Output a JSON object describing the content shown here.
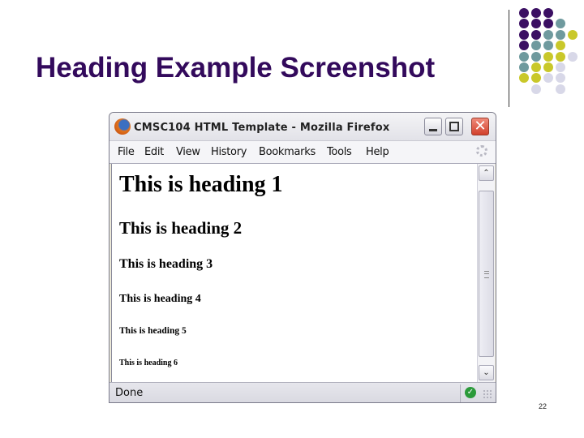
{
  "slide": {
    "title": "Heading Example Screenshot",
    "page_number": "22",
    "colors": {
      "title": "#330a5c",
      "dot_purple": "#3b0f63",
      "dot_teal": "#6f9a9e",
      "dot_yellow": "#c9c82a",
      "dot_lavender": "#d8d8e8"
    }
  },
  "browser": {
    "window_title": "CMSC104 HTML Template - Mozilla Firefox",
    "menu": [
      "File",
      "Edit",
      "View",
      "History",
      "Bookmarks",
      "Tools",
      "Help"
    ],
    "content": {
      "h1": "This is heading 1",
      "h2": "This is heading 2",
      "h3": "This is heading 3",
      "h4": "This is heading 4",
      "h5": "This is heading 5",
      "h6": "This is heading 6"
    },
    "status": "Done",
    "icons": {
      "app": "firefox-icon",
      "minimize": "minimize-icon",
      "maximize": "maximize-icon",
      "close": "close-icon",
      "throbber": "throbber-icon",
      "scroll_up": "chevron-up-icon",
      "scroll_down": "chevron-down-icon",
      "secure": "check-circle-icon"
    },
    "glyphs": {
      "close": "✕",
      "up": "⌃",
      "down": "⌄",
      "check": "✓"
    }
  }
}
